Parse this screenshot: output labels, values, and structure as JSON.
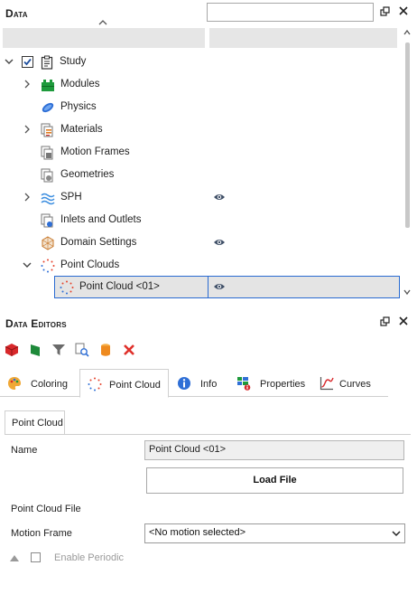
{
  "data_panel": {
    "title": "Data",
    "search": {
      "value": "",
      "placeholder": ""
    },
    "tree": [
      {
        "label": "Study",
        "checked": true,
        "icon": "clipboard-icon"
      },
      {
        "label": "Modules",
        "icon": "modules-icon"
      },
      {
        "label": "Physics",
        "icon": "physics-icon"
      },
      {
        "label": "Materials",
        "icon": "materials-icon"
      },
      {
        "label": "Motion Frames",
        "icon": "motion-frames-icon"
      },
      {
        "label": "Geometries",
        "icon": "geometries-icon"
      },
      {
        "label": "SPH",
        "icon": "sph-waves-icon",
        "visible": true
      },
      {
        "label": "Inlets and Outlets",
        "icon": "inlets-icon"
      },
      {
        "label": "Domain Settings",
        "icon": "domain-icon",
        "visible": true
      },
      {
        "label": "Point Clouds",
        "icon": "point-cloud-icon"
      },
      {
        "label": "Point Cloud <01>",
        "icon": "point-cloud-icon",
        "visible": true,
        "selected": true
      }
    ]
  },
  "editors_panel": {
    "title": "Data Editors",
    "toolbar": [
      "add-cube-icon",
      "flag-icon",
      "filter-icon",
      "search-list-icon",
      "cylinder-icon",
      "delete-icon"
    ],
    "tabs": [
      {
        "label": "Coloring",
        "icon": "palette-icon"
      },
      {
        "label": "Point Cloud",
        "icon": "point-cloud-icon",
        "active": true
      },
      {
        "label": "Info",
        "icon": "info-icon"
      },
      {
        "label": "Properties",
        "icon": "properties-icon"
      },
      {
        "label": "Curves",
        "icon": "curves-icon"
      }
    ],
    "subtab": "Point Cloud",
    "fields": {
      "name_label": "Name",
      "name_value": "Point Cloud <01>",
      "load_button": "Load File",
      "file_label": "Point Cloud File",
      "motion_label": "Motion Frame",
      "motion_value": "<No motion selected>",
      "periodic_label": "Enable Periodic"
    }
  },
  "colors": {
    "accent": "#2a6bd1",
    "header_bg": "#e6e6e6",
    "selected_bg": "#e4e4e4"
  }
}
